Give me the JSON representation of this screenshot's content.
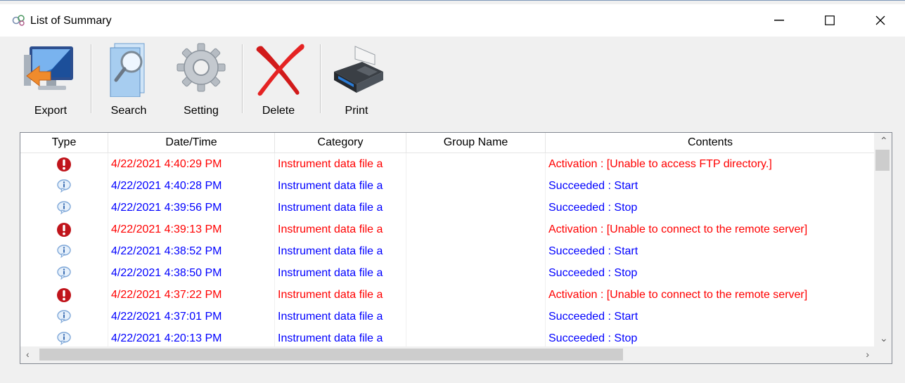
{
  "window": {
    "title": "List of Summary",
    "controls": {
      "minimize": "—",
      "maximize": "☐",
      "close": "✕"
    }
  },
  "toolbar": {
    "export_label": "Export",
    "search_label": "Search",
    "setting_label": "Setting",
    "delete_label": "Delete",
    "print_label": "Print"
  },
  "table": {
    "columns": [
      "Type",
      "Date/Time",
      "Category",
      "Group Name",
      "Contents"
    ],
    "rows": [
      {
        "type": "error",
        "datetime": "4/22/2021 4:40:29 PM",
        "category": "Instrument data file a",
        "group": "",
        "contents": "Activation : [Unable to access FTP directory.]"
      },
      {
        "type": "info",
        "datetime": "4/22/2021 4:40:28 PM",
        "category": "Instrument data file a",
        "group": "",
        "contents": "Succeeded : Start"
      },
      {
        "type": "info",
        "datetime": "4/22/2021 4:39:56 PM",
        "category": "Instrument data file a",
        "group": "",
        "contents": "Succeeded : Stop"
      },
      {
        "type": "error",
        "datetime": "4/22/2021 4:39:13 PM",
        "category": "Instrument data file a",
        "group": "",
        "contents": "Activation : [Unable to connect to the remote server]"
      },
      {
        "type": "info",
        "datetime": "4/22/2021 4:38:52 PM",
        "category": "Instrument data file a",
        "group": "",
        "contents": "Succeeded : Start"
      },
      {
        "type": "info",
        "datetime": "4/22/2021 4:38:50 PM",
        "category": "Instrument data file a",
        "group": "",
        "contents": "Succeeded : Stop"
      },
      {
        "type": "error",
        "datetime": "4/22/2021 4:37:22 PM",
        "category": "Instrument data file a",
        "group": "",
        "contents": "Activation : [Unable to connect to the remote server]"
      },
      {
        "type": "info",
        "datetime": "4/22/2021 4:37:01 PM",
        "category": "Instrument data file a",
        "group": "",
        "contents": "Succeeded : Start"
      },
      {
        "type": "info",
        "datetime": "4/22/2021 4:20:13 PM",
        "category": "Instrument data file a",
        "group": "",
        "contents": "Succeeded : Stop"
      }
    ]
  },
  "colors": {
    "error_text": "#ff0000",
    "info_text": "#0000ff",
    "error_icon": "#c0141b",
    "info_icon": "#7ea7d8"
  }
}
